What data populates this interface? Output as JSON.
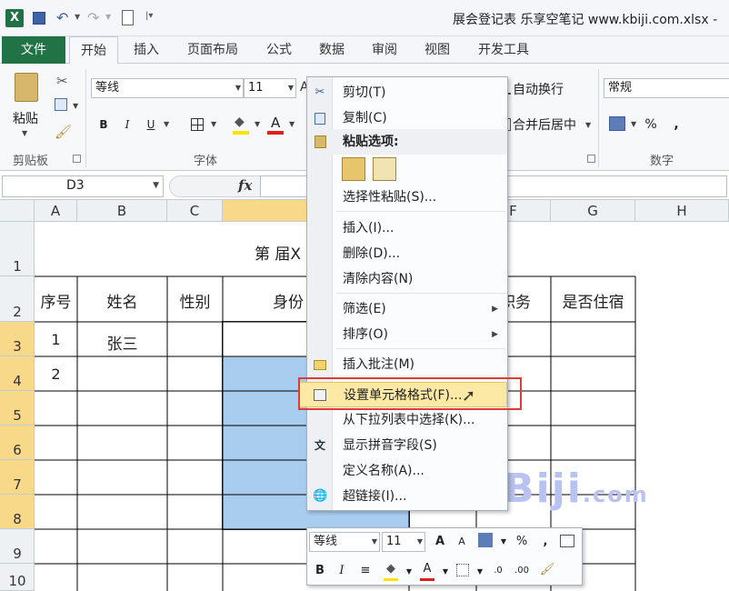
{
  "titlebar": {
    "title": "展会登记表 乐享空笔记 www.kbiji.com.xlsx -"
  },
  "ribbon_tabs": [
    "文件",
    "开始",
    "插入",
    "页面布局",
    "公式",
    "数据",
    "审阅",
    "视图",
    "开发工具"
  ],
  "ribbon": {
    "clipboard": {
      "paste_label": "粘贴",
      "group_label": "剪贴板"
    },
    "font": {
      "font_name": "等线",
      "font_size": "11",
      "bold": "B",
      "italic": "I",
      "underline": "U",
      "group_label": "字体",
      "font_color_letter": "A"
    },
    "alignment": {
      "wrap_text": "自动换行",
      "merge_center": "合并后居中"
    },
    "number": {
      "format": "常规",
      "percent": "%",
      "comma": ",",
      "group_label": "数字"
    }
  },
  "formula_bar": {
    "name_box": "D3",
    "fx": "fx",
    "formula": ""
  },
  "grid": {
    "columns": [
      "A",
      "B",
      "C",
      "",
      "",
      "F",
      "G",
      "H"
    ],
    "rows": [
      "1",
      "2",
      "3",
      "4",
      "5",
      "6",
      "7",
      "8",
      "9",
      "10"
    ],
    "title_cell": "第 届X",
    "headers": {
      "a": "序号",
      "b": "姓名",
      "c": "性别",
      "d": "身份",
      "f": "职务",
      "g": "是否住宿"
    },
    "row3": {
      "a": "1",
      "b": "张三"
    },
    "row4": {
      "a": "2"
    }
  },
  "context_menu": {
    "items": [
      {
        "label": "剪切(T)",
        "icon": "scissors-icon"
      },
      {
        "label": "复制(C)",
        "icon": "copy-icon"
      },
      {
        "label": "粘贴选项:",
        "icon": "paste-icon"
      },
      {
        "label": "选择性粘贴(S)..."
      },
      {
        "label": "插入(I)..."
      },
      {
        "label": "删除(D)..."
      },
      {
        "label": "清除内容(N)"
      },
      {
        "label": "筛选(E)"
      },
      {
        "label": "排序(O)"
      },
      {
        "label": "插入批注(M)",
        "icon": "comment-icon"
      },
      {
        "label": "设置单元格格式(F)...",
        "icon": "format-cells-icon"
      },
      {
        "label": "从下拉列表中选择(K)..."
      },
      {
        "label": "显示拼音字段(S)",
        "icon": "phonetic-icon"
      },
      {
        "label": "定义名称(A)..."
      },
      {
        "label": "超链接(I)...",
        "icon": "hyperlink-icon"
      }
    ]
  },
  "mini_toolbar": {
    "font_name": "等线",
    "font_size": "11",
    "percent": "%",
    "comma": ","
  },
  "watermark": {
    "text": "KBiji",
    "suffix": ".com"
  },
  "colors": {
    "accent_green": "#217346",
    "selection_blue": "#a9cdef",
    "highlight_red": "#e03b3b",
    "header_selected": "#f8d98a"
  }
}
